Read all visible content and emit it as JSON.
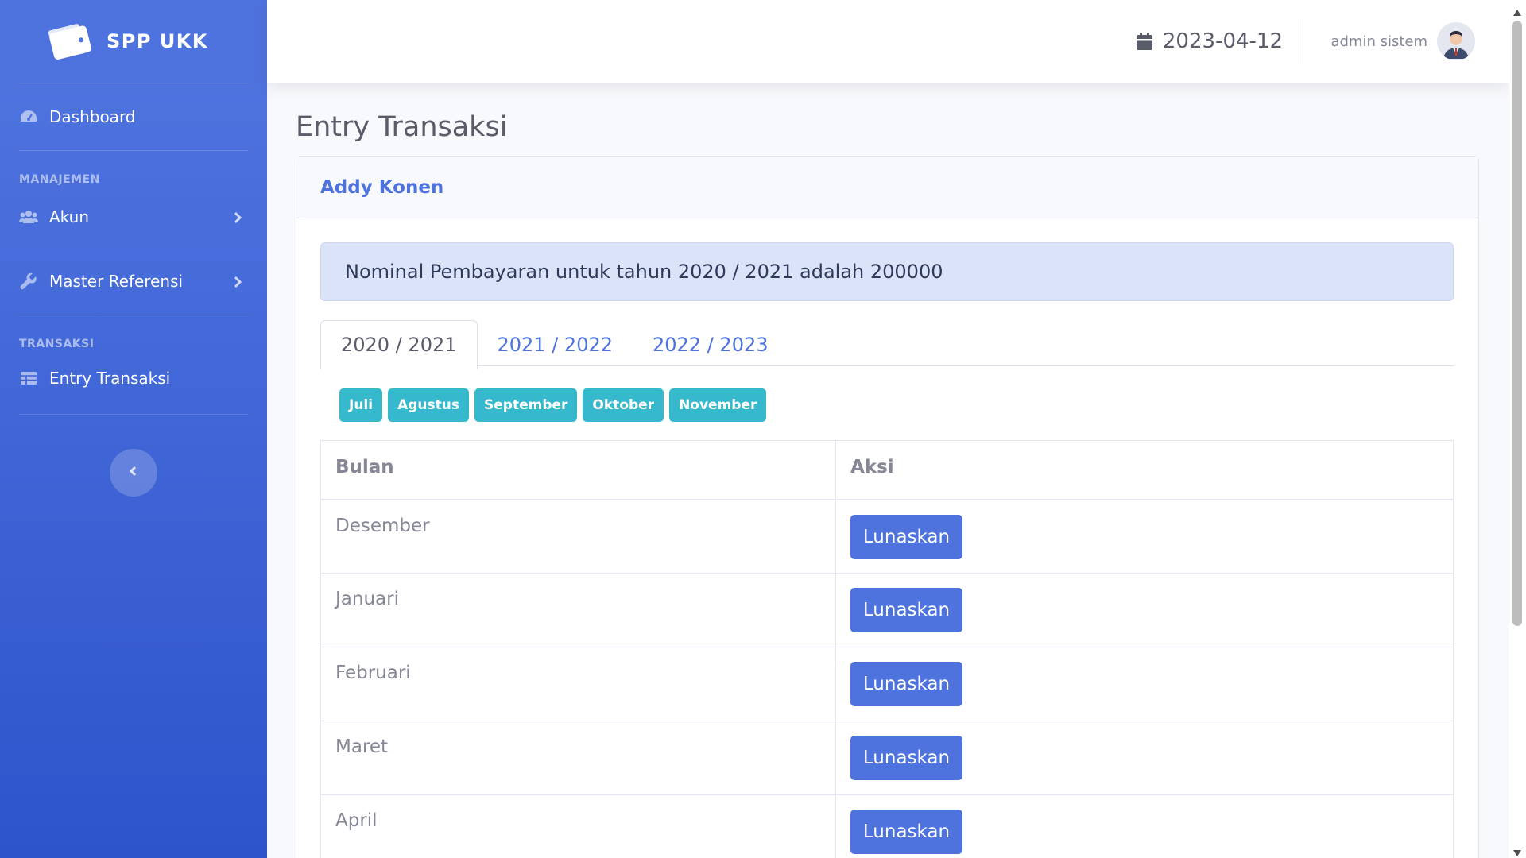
{
  "sidebar": {
    "brand": "SPP UKK",
    "items": {
      "dashboard": "Dashboard",
      "akun": "Akun",
      "master_referensi": "Master Referensi",
      "entry_transaksi": "Entry Transaksi"
    },
    "headings": {
      "manajemen": "MANAJEMEN",
      "transaksi": "TRANSAKSI"
    }
  },
  "topbar": {
    "date": "2023-04-12",
    "username": "admin sistem"
  },
  "page": {
    "title": "Entry Transaksi"
  },
  "card": {
    "student_name": "Addy Konen",
    "alert": "Nominal Pembayaran untuk tahun 2020 / 2021 adalah 200000",
    "tabs": [
      "2020 / 2021",
      "2021 / 2022",
      "2022 / 2023"
    ],
    "active_tab": "2020 / 2021",
    "paid_months": [
      "Juli",
      "Agustus",
      "September",
      "Oktober",
      "November"
    ],
    "table": {
      "headers": [
        "Bulan",
        "Aksi"
      ],
      "rows": [
        {
          "bulan": "Desember",
          "aksi": "Lunaskan"
        },
        {
          "bulan": "Januari",
          "aksi": "Lunaskan"
        },
        {
          "bulan": "Februari",
          "aksi": "Lunaskan"
        },
        {
          "bulan": "Maret",
          "aksi": "Lunaskan"
        },
        {
          "bulan": "April",
          "aksi": "Lunaskan"
        }
      ]
    }
  },
  "colors": {
    "primary": "#4e73df",
    "info": "#36b9cc",
    "alert_bg": "#dbe3f8"
  }
}
